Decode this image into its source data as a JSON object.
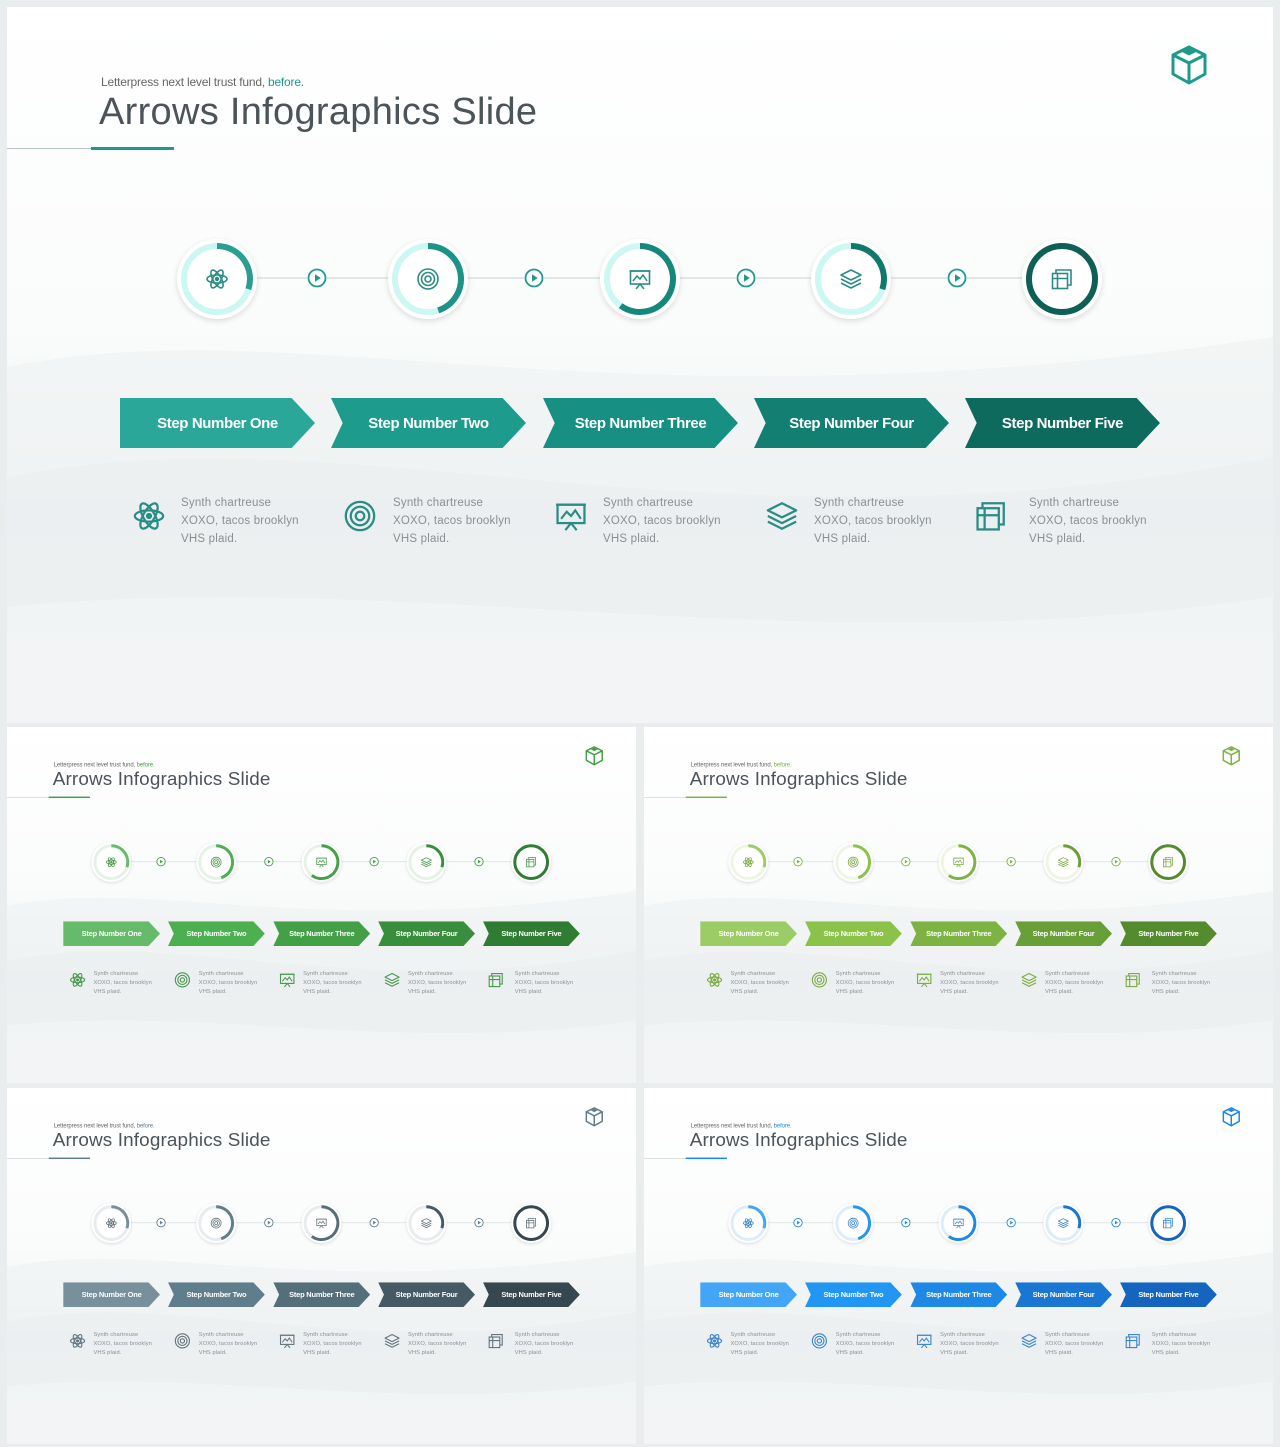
{
  "slide": {
    "subtitle": "Letterpress next level trust fund,",
    "subtitle_accent": "before.",
    "title": "Arrows Infographics Slide",
    "steps": [
      {
        "label": "Step Number One",
        "icon": "atom-icon",
        "lines": [
          "Synth chartreuse",
          "XOXO, tacos brooklyn",
          "VHS plaid."
        ]
      },
      {
        "label": "Step Number Two",
        "icon": "target-icon",
        "lines": [
          "Synth chartreuse",
          "XOXO, tacos brooklyn",
          "VHS plaid."
        ]
      },
      {
        "label": "Step Number Three",
        "icon": "presentation-board-icon",
        "lines": [
          "Synth chartreuse",
          "XOXO, tacos brooklyn",
          "VHS plaid."
        ]
      },
      {
        "label": "Step Number Four",
        "icon": "layers-icon",
        "lines": [
          "Synth chartreuse",
          "XOXO, tacos brooklyn",
          "VHS plaid."
        ]
      },
      {
        "label": "Step Number Five",
        "icon": "stacked-pages-icon",
        "lines": [
          "Synth chartreuse",
          "XOXO, tacos brooklyn",
          "VHS plaid."
        ]
      }
    ],
    "progress": [
      0.3,
      0.45,
      0.6,
      0.3,
      1.0
    ]
  },
  "themes": [
    {
      "name": "teal",
      "accent": "#1e9a8d",
      "arrows": [
        "#2aa799",
        "#1d9c8e",
        "#178f82",
        "#127f72",
        "#0f6a5e"
      ],
      "ring_track": "#cdf7f3",
      "arcs": [
        "#2a9f91",
        "#1b9385",
        "#14897b",
        "#10796c",
        "#0e5f55"
      ],
      "icon_color": "#2a8c85"
    },
    {
      "name": "green",
      "accent": "#43a047",
      "arrows": [
        "#66bb6a",
        "#4caf50",
        "#43a047",
        "#388e3c",
        "#2e7d32"
      ],
      "ring_track": "#e4f3e5",
      "arcs": [
        "#66bb6a",
        "#4caf50",
        "#43a047",
        "#388e3c",
        "#2e7d32"
      ],
      "icon_color": "#4a9a4e"
    },
    {
      "name": "lime",
      "accent": "#7cb342",
      "arrows": [
        "#9ccc65",
        "#8bc34a",
        "#7cb342",
        "#689f38",
        "#558b2f"
      ],
      "ring_track": "#eef6e3",
      "arcs": [
        "#9ccc65",
        "#8bc34a",
        "#7cb342",
        "#689f38",
        "#558b2f"
      ],
      "icon_color": "#7cab45"
    },
    {
      "name": "slate",
      "accent": "#607d8b",
      "arrows": [
        "#78909c",
        "#607d8b",
        "#546e7a",
        "#455a64",
        "#37474f"
      ],
      "ring_track": "#e7ecef",
      "arcs": [
        "#78909c",
        "#607d8b",
        "#546e7a",
        "#455a64",
        "#37474f"
      ],
      "icon_color": "#66757d"
    },
    {
      "name": "blue",
      "accent": "#1e88e5",
      "arrows": [
        "#42a5f5",
        "#2196f3",
        "#1e88e5",
        "#1976d2",
        "#1565c0"
      ],
      "ring_track": "#dcecfb",
      "arcs": [
        "#42a5f5",
        "#2196f3",
        "#1e88e5",
        "#1976d2",
        "#1565c0"
      ],
      "icon_color": "#3c86c9"
    }
  ]
}
